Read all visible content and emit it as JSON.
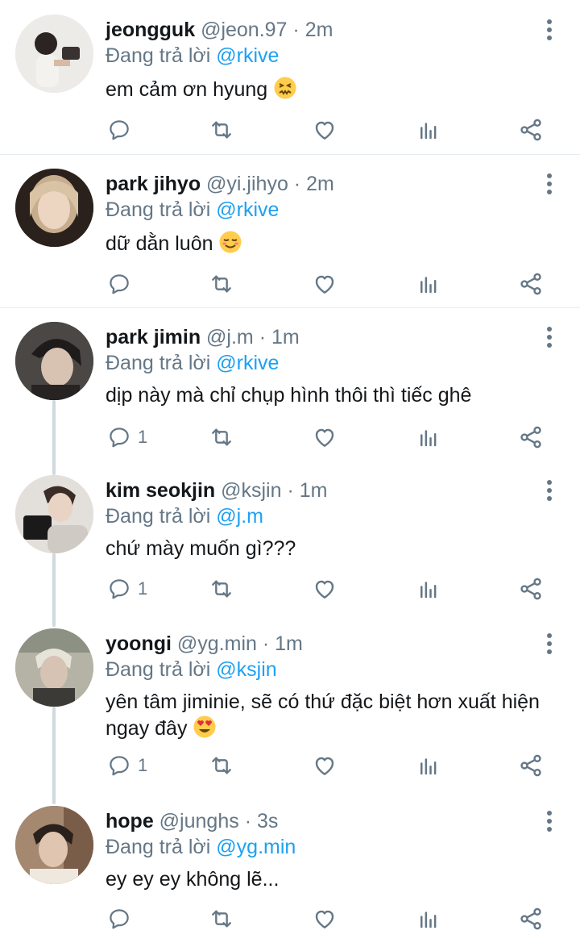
{
  "tweets": [
    {
      "name": "jeongguk",
      "handle": "@jeon.97",
      "separator": "·",
      "time": "2m",
      "reply_prefix": "Đang trả lời",
      "reply_to": "@rkive",
      "text": "em cảm ơn hyung",
      "emoji": "confounded-face",
      "reply_count": ""
    },
    {
      "name": "park jihyo",
      "handle": "@yi.jihyo",
      "separator": "·",
      "time": "2m",
      "reply_prefix": "Đang trả lời",
      "reply_to": "@rkive",
      "text": "dữ dằn luôn",
      "emoji": "relieved-face",
      "reply_count": ""
    },
    {
      "name": "park jimin",
      "handle": "@j.m",
      "separator": "·",
      "time": "1m",
      "reply_prefix": "Đang trả lời",
      "reply_to": "@rkive",
      "text": "dịp này mà chỉ chụp hình thôi thì tiếc ghê",
      "emoji": "",
      "reply_count": "1"
    },
    {
      "name": "kim seokjin",
      "handle": "@ksjin",
      "separator": "·",
      "time": "1m",
      "reply_prefix": "Đang trả lời",
      "reply_to": "@j.m",
      "text": "chứ mày muốn gì???",
      "emoji": "",
      "reply_count": "1"
    },
    {
      "name": "yoongi",
      "handle": "@yg.min",
      "separator": "·",
      "time": "1m",
      "reply_prefix": "Đang trả lời",
      "reply_to": "@ksjin",
      "text": "yên tâm jiminie, sẽ có thứ đặc biệt hơn xuất hiện ngay đây",
      "emoji": "heart-eyes-face",
      "reply_count": "1"
    },
    {
      "name": "hope",
      "handle": "@junghs",
      "separator": "·",
      "time": "3s",
      "reply_prefix": "Đang trả lời",
      "reply_to": "@yg.min",
      "text": "ey ey ey không lẽ...",
      "emoji": "",
      "reply_count": ""
    }
  ],
  "icons": {
    "reply": "comment-icon",
    "retweet": "retweet-icon",
    "like": "heart-icon",
    "analytics": "analytics-icon",
    "share": "share-icon",
    "more": "more-vertical-icon"
  },
  "colors": {
    "accent": "#1da1f2",
    "secondary_text": "#657786",
    "divider": "#e6ecf0",
    "thread_line": "#cfd9de"
  }
}
